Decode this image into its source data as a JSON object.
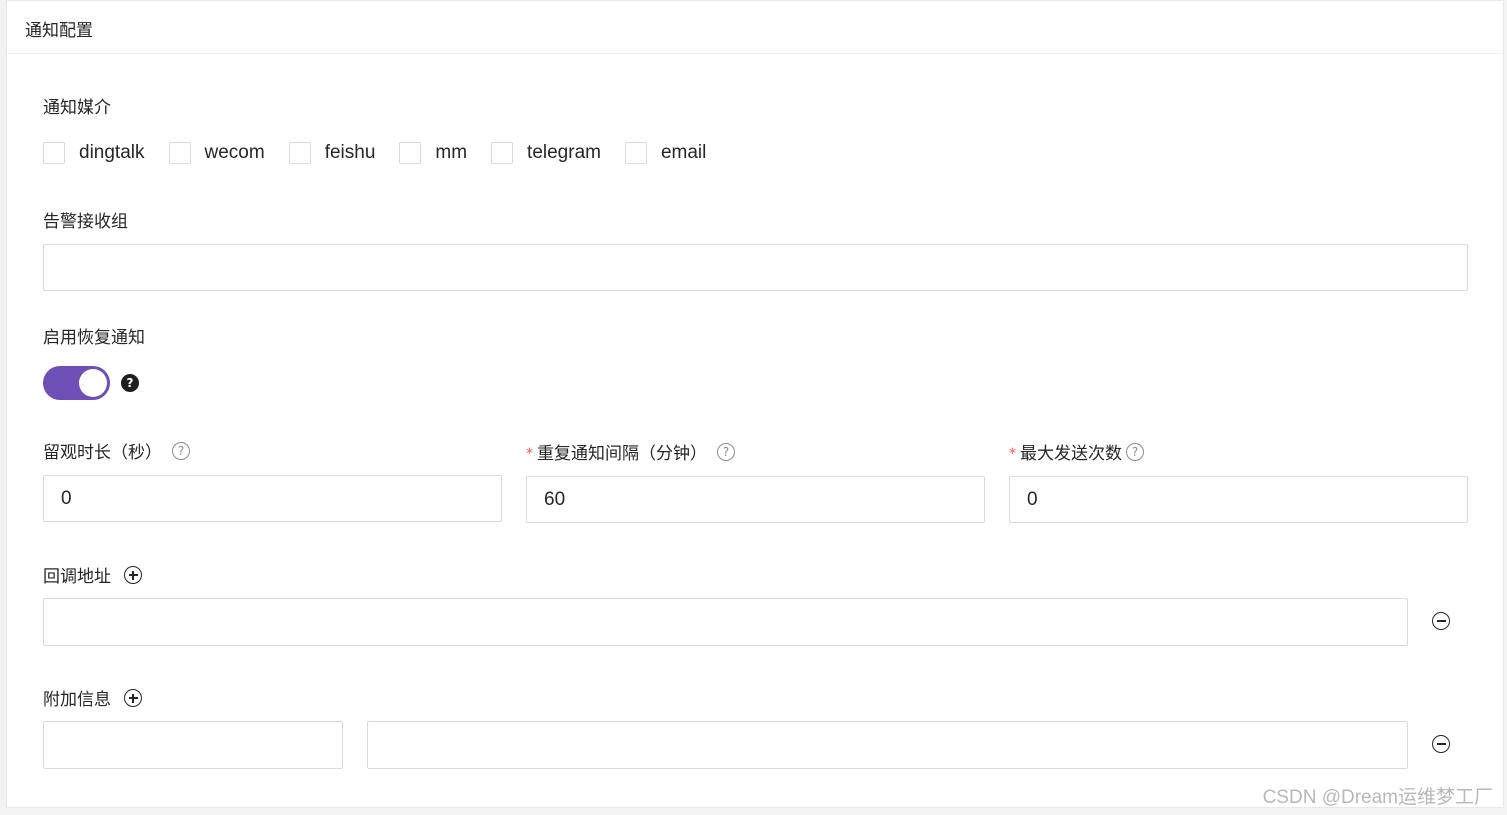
{
  "card": {
    "title": "通知配置"
  },
  "notify_media": {
    "label": "通知媒介",
    "options": [
      "dingtalk",
      "wecom",
      "feishu",
      "mm",
      "telegram",
      "email"
    ]
  },
  "receiver_group": {
    "label": "告警接收组",
    "value": ""
  },
  "recovery_notify": {
    "label": "启用恢复通知",
    "enabled": true,
    "help": "?"
  },
  "observe_duration": {
    "label": "留观时长（秒）",
    "value": "0",
    "help": "?"
  },
  "repeat_interval": {
    "required_mark": "*",
    "label": "重复通知间隔（分钟）",
    "value": "60",
    "help": "?"
  },
  "max_send": {
    "required_mark": "*",
    "label": "最大发送次数",
    "value": "0",
    "help": "?"
  },
  "callback": {
    "label": "回调地址",
    "value": ""
  },
  "extra_info": {
    "label": "附加信息",
    "key": "",
    "value": ""
  },
  "watermark": "CSDN @Dream运维梦工厂",
  "colors": {
    "accent": "#6e4fb6",
    "required": "#ff4d4f"
  }
}
